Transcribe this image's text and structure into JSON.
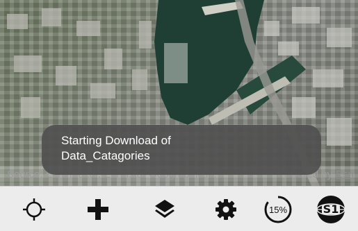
{
  "map": {
    "attribution": {
      "source_text": "Source: Esri, Maxar, Earthstar Geographics...",
      "powered_text": "Powered by",
      "esri_link": "Esri"
    }
  },
  "toast": {
    "line1": "Starting Download of",
    "line2": "Data_Catagories"
  },
  "toolbar": {
    "progress_label": "15%",
    "progress_fraction": 0.15,
    "logo_text": "S1",
    "icons": [
      "crosshair-icon",
      "plus-icon",
      "layers-icon",
      "gear-icon",
      "progress-ring",
      "logo-globe-icon"
    ]
  },
  "colors": {
    "water": "#1f3f34",
    "toast_bg": "#505050",
    "toolbar_bg": "#ececec",
    "icon": "#111111"
  }
}
